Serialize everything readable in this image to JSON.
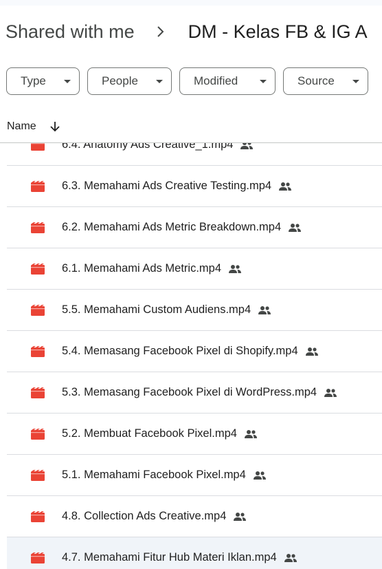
{
  "breadcrumb": {
    "root": "Shared with me",
    "current": "DM - Kelas FB & IG A"
  },
  "filters": {
    "type": "Type",
    "people": "People",
    "modified": "Modified",
    "source": "Source"
  },
  "list_header": {
    "name": "Name",
    "sort_icon": "arrow-down-icon"
  },
  "files": [
    {
      "name": "6.4. Anatomy Ads Creative_1.mp4",
      "icon": "video-file-icon",
      "shared": true
    },
    {
      "name": "6.3. Memahami Ads Creative Testing.mp4",
      "icon": "video-file-icon",
      "shared": true
    },
    {
      "name": "6.2. Memahami Ads Metric Breakdown.mp4",
      "icon": "video-file-icon",
      "shared": true
    },
    {
      "name": "6.1. Memahami Ads Metric.mp4",
      "icon": "video-file-icon",
      "shared": true
    },
    {
      "name": "5.5. Memahami Custom Audiens.mp4",
      "icon": "video-file-icon",
      "shared": true
    },
    {
      "name": "5.4. Memasang Facebook Pixel di Shopify.mp4",
      "icon": "video-file-icon",
      "shared": true
    },
    {
      "name": "5.3. Memasang Facebook Pixel di WordPress.mp4",
      "icon": "video-file-icon",
      "shared": true
    },
    {
      "name": "5.2. Membuat Facebook Pixel.mp4",
      "icon": "video-file-icon",
      "shared": true
    },
    {
      "name": "5.1. Memahami Facebook Pixel.mp4",
      "icon": "video-file-icon",
      "shared": true
    },
    {
      "name": "4.8. Collection Ads Creative.mp4",
      "icon": "video-file-icon",
      "shared": true
    },
    {
      "name": "4.7. Memahami Fitur Hub Materi Iklan.mp4",
      "icon": "video-file-icon",
      "shared": true
    }
  ],
  "colors": {
    "video_icon": "#ea4335",
    "text": "#1f1f1f",
    "muted": "#444746",
    "border": "#dadce0",
    "hover_row": "#f0f4f9"
  }
}
